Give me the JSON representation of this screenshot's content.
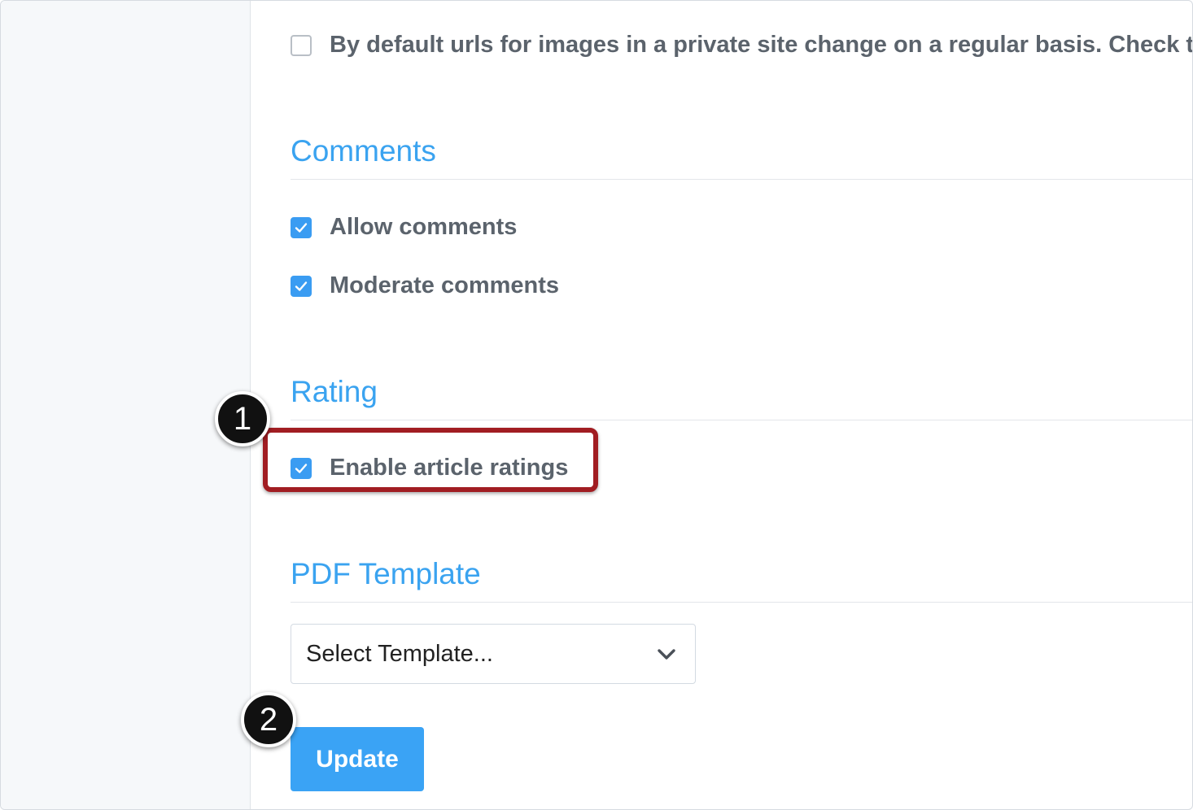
{
  "private_images": {
    "checked": false,
    "label": "By default urls for images in a private site change on a regular basis. Check this"
  },
  "comments": {
    "title": "Comments",
    "options": [
      {
        "label": "Allow comments",
        "checked": true
      },
      {
        "label": "Moderate comments",
        "checked": true
      }
    ]
  },
  "rating": {
    "title": "Rating",
    "option": {
      "label": "Enable article ratings",
      "checked": true
    }
  },
  "pdf_template": {
    "title": "PDF Template",
    "select_value": "Select Template..."
  },
  "actions": {
    "update_label": "Update"
  },
  "annotations": {
    "step1": "1",
    "step2": "2"
  },
  "colors": {
    "accent": "#3a9cf2",
    "section_title": "#3aa3f0",
    "highlight": "#a11d22",
    "button": "#3aa3f5"
  },
  "icons": {
    "check": "check-icon",
    "dropdown": "chevron-down-icon"
  }
}
